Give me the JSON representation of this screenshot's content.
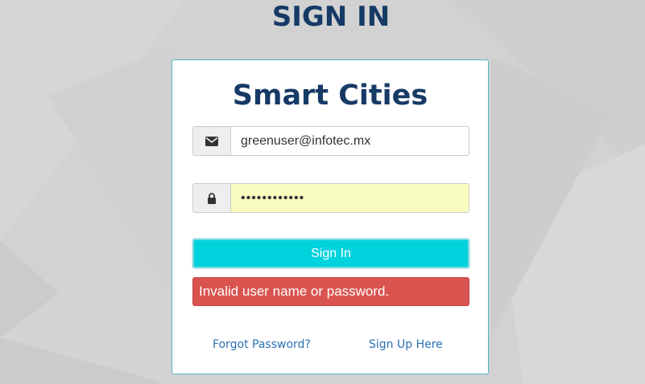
{
  "header": {
    "title": "SIGN IN"
  },
  "card": {
    "brand": "Smart Cities",
    "email": {
      "icon": "envelope-icon",
      "value": "greenuser@infotec.mx"
    },
    "password": {
      "icon": "lock-icon",
      "value": "••••••••••••",
      "autofilled": true
    },
    "signin_label": "Sign In",
    "error_message": "Invalid user name or password.",
    "forgot_password_label": "Forgot Password?",
    "signup_label": "Sign Up Here"
  },
  "colors": {
    "title": "#163a66",
    "button": "#00d2de",
    "error": "#d9534f",
    "link": "#2a70b5",
    "autofill": "#fafdc0"
  }
}
